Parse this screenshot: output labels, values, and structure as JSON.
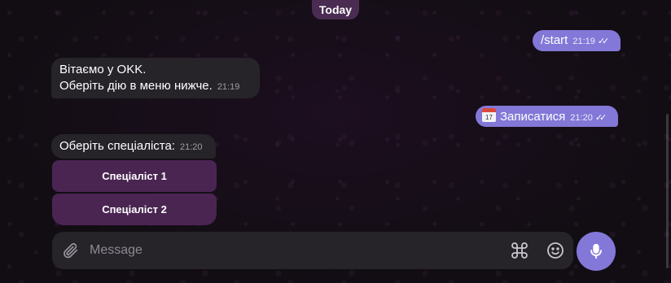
{
  "date_separator": "Today",
  "messages": {
    "start": {
      "text": "/start",
      "time": "21:19",
      "ticks": "✓✓"
    },
    "welcome": {
      "line1": "Вітаємо у OKK.",
      "line2": "Оберіть дію в меню нижче.",
      "time": "21:19"
    },
    "signup": {
      "icon_day": "17",
      "text": "Записатися",
      "time": "21:20",
      "ticks": "✓✓"
    },
    "choose": {
      "text": "Оберіть спеціаліста:",
      "time": "21:20"
    }
  },
  "keyboard": {
    "buttons": [
      "Спеціаліст 1",
      "Спеціаліст 2"
    ]
  },
  "composer": {
    "placeholder": "Message",
    "icons": [
      "paperclip-icon",
      "command-icon",
      "smile-icon",
      "microphone-icon"
    ]
  },
  "colors": {
    "accent": "#8378d8",
    "incoming_bubble": "#262329",
    "keyboard_button": "#4a2552",
    "date_pill": "#4a2b52",
    "background": "#120d13"
  }
}
